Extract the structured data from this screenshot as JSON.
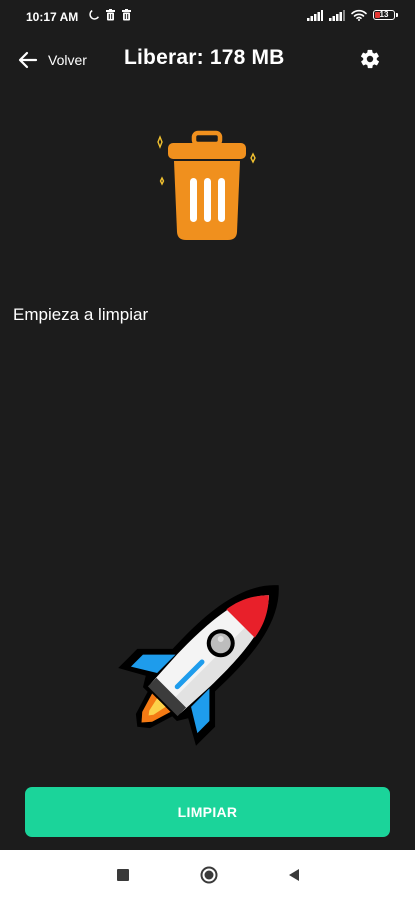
{
  "status_bar": {
    "time": "10:17 AM",
    "left_icons": [
      "moon-icon",
      "trash-notification-icon",
      "trash-notification-icon"
    ],
    "right_icons": [
      "signal-icon",
      "signal-icon",
      "wifi-icon",
      "battery-icon"
    ],
    "battery_level": "13",
    "battery_low_color": "#e53935"
  },
  "toolbar": {
    "back_label": "Volver",
    "title": "Liberar: 178 MB",
    "back_icon": "arrow-left-icon",
    "settings_icon": "gear-icon"
  },
  "main": {
    "message": "Empieza a limpiar",
    "trash_icon": "trash-can-icon",
    "rocket_icon": "rocket-icon"
  },
  "action": {
    "clean_label": "LIMPIAR"
  },
  "colors": {
    "background": "#1c1c1c",
    "accent": "#1bd49a",
    "trash": "#f0901e",
    "rocket_red": "#e8202a",
    "rocket_blue": "#1e9cec",
    "flame": "#f47a14"
  },
  "nav_bar": {
    "icons": [
      "recents-square-icon",
      "home-circle-icon",
      "back-triangle-icon"
    ]
  }
}
